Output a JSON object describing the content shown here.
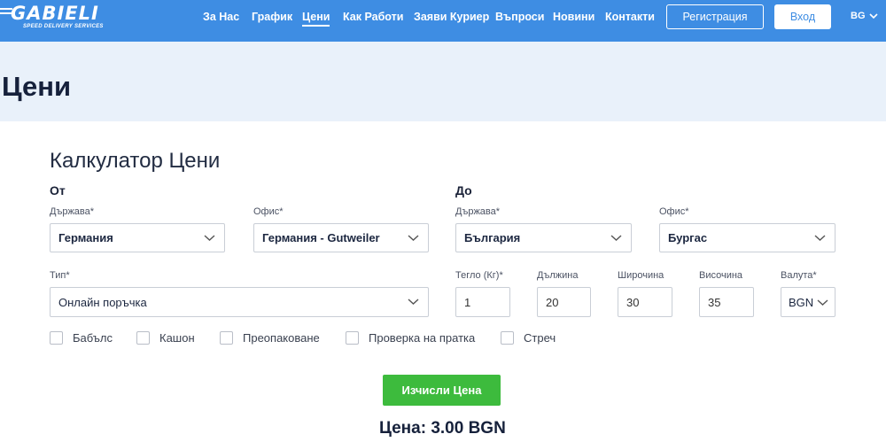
{
  "logo": {
    "main": "GABIELI",
    "sub": "SPEED DELIVERY SERVICES"
  },
  "nav": {
    "links": [
      "За Нас",
      "График",
      "Цени",
      "Как Работи",
      "Заяви Куриер",
      "Въпроси",
      "Новини",
      "Контакти"
    ],
    "active": "Цени",
    "register": "Регистрация",
    "login": "Вход",
    "lang": "BG"
  },
  "page": {
    "title": "Цени"
  },
  "calculator": {
    "title": "Калкулатор Цени",
    "from": {
      "heading": "От",
      "country_label": "Държава*",
      "country_value": "Германия",
      "office_label": "Офис*",
      "office_value": "Германия - Gutweiler"
    },
    "to": {
      "heading": "До",
      "country_label": "Държава*",
      "country_value": "България",
      "office_label": "Офис*",
      "office_value": "Бургас"
    },
    "type_label": "Тип*",
    "type_value": "Онлайн поръчка",
    "weight_label": "Тегло (Кг)*",
    "weight_value": "1",
    "length_label": "Дължина",
    "length_value": "20",
    "width_label": "Широчина",
    "width_value": "30",
    "height_label": "Височина",
    "height_value": "35",
    "currency_label": "Валута*",
    "currency_value": "BGN",
    "options": [
      "Бабълс",
      "Кашон",
      "Преопаковане",
      "Проверка на пратка",
      "Стреч"
    ],
    "calculate_button": "Изчисли Цена",
    "result": "Цена: 3.00 BGN"
  },
  "colors": {
    "nav_bg": "#3e8de3",
    "button_green": "#3dbb3d",
    "page_bg": "#e9f1fa"
  },
  "icons": {
    "dropdown": "chevron-down-icon",
    "checkbox": "checkbox-icon"
  }
}
